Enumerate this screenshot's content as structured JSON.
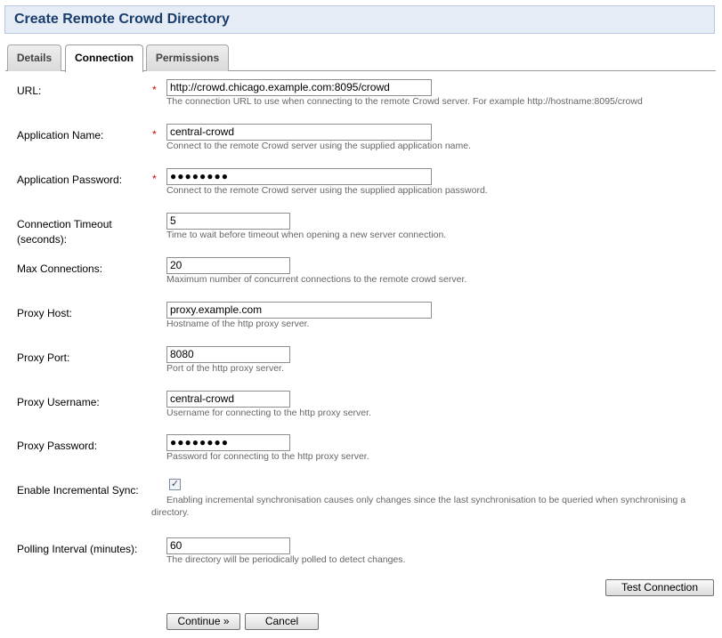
{
  "page": {
    "title": "Create Remote Crowd Directory"
  },
  "tabs": [
    {
      "label": "Details"
    },
    {
      "label": "Connection"
    },
    {
      "label": "Permissions"
    }
  ],
  "required_marker": "*",
  "fields": {
    "url": {
      "label": "URL:",
      "value": "http://crowd.chicago.example.com:8095/crowd",
      "description": "The connection URL to use when connecting to the remote Crowd server. For example http://hostname:8095/crowd"
    },
    "app_name": {
      "label": "Application Name:",
      "value": "central-crowd",
      "description": "Connect to the remote Crowd server using the supplied application name."
    },
    "app_password": {
      "label": "Application Password:",
      "value": "●●●●●●●●",
      "description": "Connect to the remote Crowd server using the supplied application password."
    },
    "timeout": {
      "label": "Connection Timeout (seconds):",
      "value": "5",
      "description": "Time to wait before timeout when opening a new server connection."
    },
    "max_connections": {
      "label": "Max Connections:",
      "value": "20",
      "description": "Maximum number of concurrent connections to the remote crowd server."
    },
    "proxy_host": {
      "label": "Proxy Host:",
      "value": "proxy.example.com",
      "description": "Hostname of the http proxy server."
    },
    "proxy_port": {
      "label": "Proxy Port:",
      "value": "8080",
      "description": "Port of the http proxy server."
    },
    "proxy_username": {
      "label": "Proxy Username:",
      "value": "central-crowd",
      "description": "Username for connecting to the http proxy server."
    },
    "proxy_password": {
      "label": "Proxy Password:",
      "value": "●●●●●●●●",
      "description": "Password for connecting to the http proxy server."
    },
    "incremental_sync": {
      "label": "Enable Incremental Sync:",
      "checked_glyph": "✓",
      "description": "Enabling incremental synchronisation causes only changes since the last synchronisation to be queried when synchronising a directory."
    },
    "polling_interval": {
      "label": "Polling Interval (minutes):",
      "value": "60",
      "description": "The directory will be periodically polled to detect changes."
    }
  },
  "buttons": {
    "test_connection": "Test Connection",
    "continue": "Continue »",
    "cancel": "Cancel"
  }
}
